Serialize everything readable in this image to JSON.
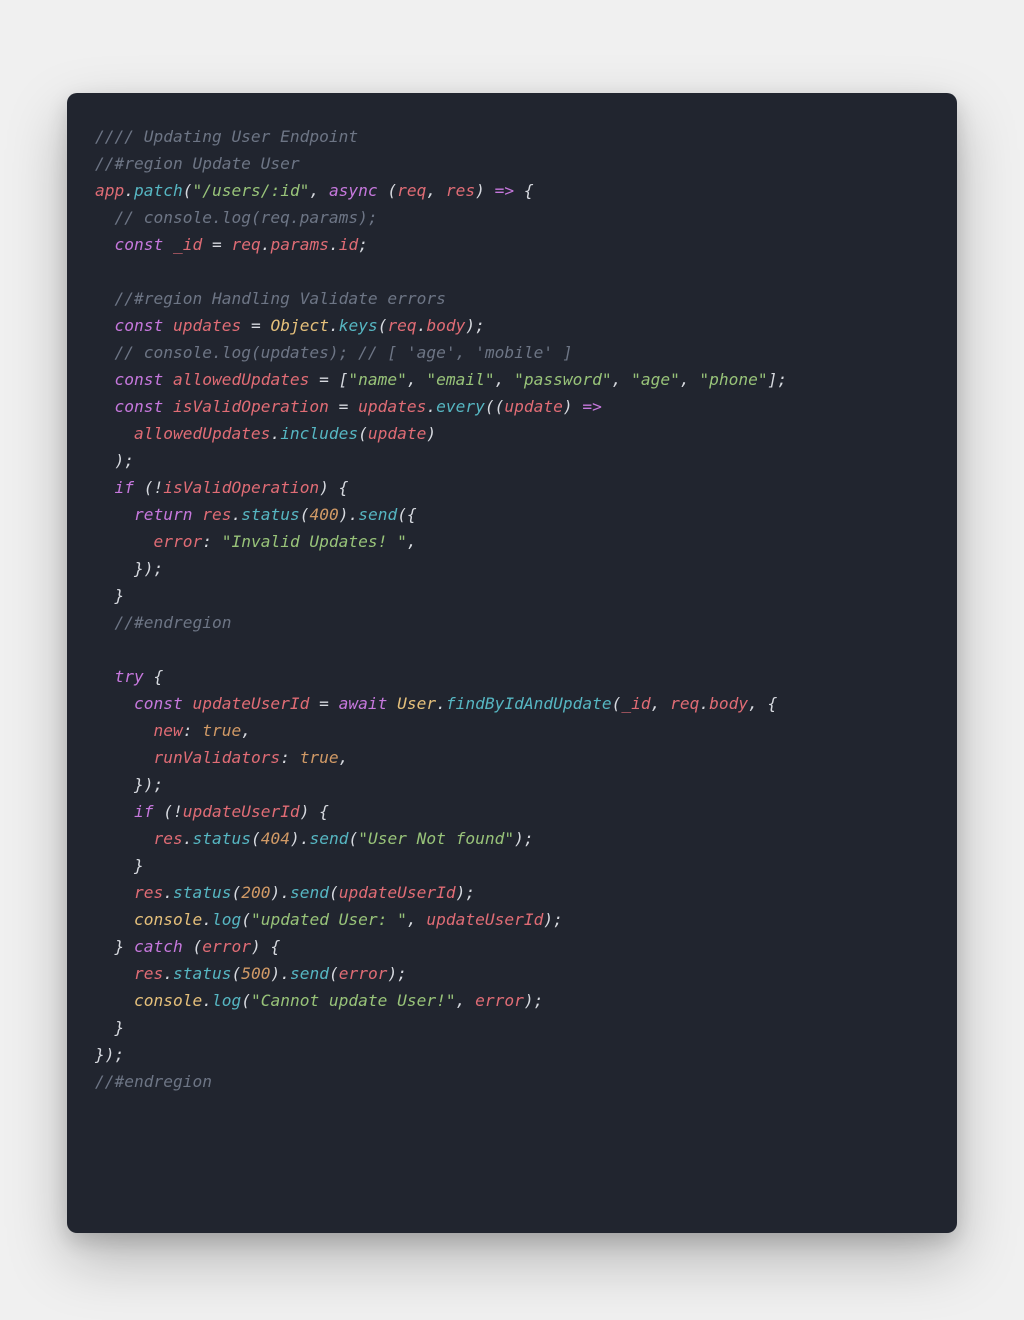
{
  "code": {
    "lines": [
      [
        {
          "c": "tok-comment",
          "t": "//// Updating User Endpoint"
        }
      ],
      [
        {
          "c": "tok-comment",
          "t": "//#region Update User"
        }
      ],
      [
        {
          "c": "tok-ident",
          "t": "app"
        },
        {
          "c": "tok-punc",
          "t": "."
        },
        {
          "c": "tok-func",
          "t": "patch"
        },
        {
          "c": "tok-punc",
          "t": "("
        },
        {
          "c": "tok-str",
          "t": "\"/users/:id\""
        },
        {
          "c": "tok-punc",
          "t": ", "
        },
        {
          "c": "tok-key",
          "t": "async"
        },
        {
          "c": "tok-punc",
          "t": " ("
        },
        {
          "c": "tok-ident",
          "t": "req"
        },
        {
          "c": "tok-punc",
          "t": ", "
        },
        {
          "c": "tok-ident",
          "t": "res"
        },
        {
          "c": "tok-punc",
          "t": ") "
        },
        {
          "c": "tok-arrow",
          "t": "=>"
        },
        {
          "c": "tok-punc",
          "t": " {"
        }
      ],
      [
        {
          "c": "tok-punc",
          "t": "  "
        },
        {
          "c": "tok-comment",
          "t": "// console.log(req.params);"
        }
      ],
      [
        {
          "c": "tok-punc",
          "t": "  "
        },
        {
          "c": "tok-key",
          "t": "const"
        },
        {
          "c": "tok-punc",
          "t": " "
        },
        {
          "c": "tok-ident",
          "t": "_id"
        },
        {
          "c": "tok-punc",
          "t": " = "
        },
        {
          "c": "tok-ident",
          "t": "req"
        },
        {
          "c": "tok-punc",
          "t": "."
        },
        {
          "c": "tok-member",
          "t": "params"
        },
        {
          "c": "tok-punc",
          "t": "."
        },
        {
          "c": "tok-member",
          "t": "id"
        },
        {
          "c": "tok-punc",
          "t": ";"
        }
      ],
      [
        {
          "c": "tok-punc",
          "t": " "
        }
      ],
      [
        {
          "c": "tok-punc",
          "t": "  "
        },
        {
          "c": "tok-comment",
          "t": "//#region Handling Validate errors"
        }
      ],
      [
        {
          "c": "tok-punc",
          "t": "  "
        },
        {
          "c": "tok-key",
          "t": "const"
        },
        {
          "c": "tok-punc",
          "t": " "
        },
        {
          "c": "tok-ident",
          "t": "updates"
        },
        {
          "c": "tok-punc",
          "t": " = "
        },
        {
          "c": "tok-builtin",
          "t": "Object"
        },
        {
          "c": "tok-punc",
          "t": "."
        },
        {
          "c": "tok-func",
          "t": "keys"
        },
        {
          "c": "tok-punc",
          "t": "("
        },
        {
          "c": "tok-ident",
          "t": "req"
        },
        {
          "c": "tok-punc",
          "t": "."
        },
        {
          "c": "tok-member",
          "t": "body"
        },
        {
          "c": "tok-punc",
          "t": ");"
        }
      ],
      [
        {
          "c": "tok-punc",
          "t": "  "
        },
        {
          "c": "tok-comment",
          "t": "// console.log(updates); // [ 'age', 'mobile' ]"
        }
      ],
      [
        {
          "c": "tok-punc",
          "t": "  "
        },
        {
          "c": "tok-key",
          "t": "const"
        },
        {
          "c": "tok-punc",
          "t": " "
        },
        {
          "c": "tok-ident",
          "t": "allowedUpdates"
        },
        {
          "c": "tok-punc",
          "t": " = ["
        },
        {
          "c": "tok-str",
          "t": "\"name\""
        },
        {
          "c": "tok-punc",
          "t": ", "
        },
        {
          "c": "tok-str",
          "t": "\"email\""
        },
        {
          "c": "tok-punc",
          "t": ", "
        },
        {
          "c": "tok-str",
          "t": "\"password\""
        },
        {
          "c": "tok-punc",
          "t": ", "
        },
        {
          "c": "tok-str",
          "t": "\"age\""
        },
        {
          "c": "tok-punc",
          "t": ", "
        },
        {
          "c": "tok-str",
          "t": "\"phone\""
        },
        {
          "c": "tok-punc",
          "t": "];"
        }
      ],
      [
        {
          "c": "tok-punc",
          "t": "  "
        },
        {
          "c": "tok-key",
          "t": "const"
        },
        {
          "c": "tok-punc",
          "t": " "
        },
        {
          "c": "tok-ident",
          "t": "isValidOperation"
        },
        {
          "c": "tok-punc",
          "t": " = "
        },
        {
          "c": "tok-ident",
          "t": "updates"
        },
        {
          "c": "tok-punc",
          "t": "."
        },
        {
          "c": "tok-func",
          "t": "every"
        },
        {
          "c": "tok-punc",
          "t": "(("
        },
        {
          "c": "tok-ident",
          "t": "update"
        },
        {
          "c": "tok-punc",
          "t": ") "
        },
        {
          "c": "tok-arrow",
          "t": "=>"
        }
      ],
      [
        {
          "c": "tok-punc",
          "t": "    "
        },
        {
          "c": "tok-ident",
          "t": "allowedUpdates"
        },
        {
          "c": "tok-punc",
          "t": "."
        },
        {
          "c": "tok-func",
          "t": "includes"
        },
        {
          "c": "tok-punc",
          "t": "("
        },
        {
          "c": "tok-ident",
          "t": "update"
        },
        {
          "c": "tok-punc",
          "t": ")"
        }
      ],
      [
        {
          "c": "tok-punc",
          "t": "  );"
        }
      ],
      [
        {
          "c": "tok-punc",
          "t": "  "
        },
        {
          "c": "tok-key",
          "t": "if"
        },
        {
          "c": "tok-punc",
          "t": " (!"
        },
        {
          "c": "tok-ident",
          "t": "isValidOperation"
        },
        {
          "c": "tok-punc",
          "t": ") {"
        }
      ],
      [
        {
          "c": "tok-punc",
          "t": "    "
        },
        {
          "c": "tok-key",
          "t": "return"
        },
        {
          "c": "tok-punc",
          "t": " "
        },
        {
          "c": "tok-ident",
          "t": "res"
        },
        {
          "c": "tok-punc",
          "t": "."
        },
        {
          "c": "tok-func",
          "t": "status"
        },
        {
          "c": "tok-punc",
          "t": "("
        },
        {
          "c": "tok-num",
          "t": "400"
        },
        {
          "c": "tok-punc",
          "t": ")."
        },
        {
          "c": "tok-func",
          "t": "send"
        },
        {
          "c": "tok-punc",
          "t": "({"
        }
      ],
      [
        {
          "c": "tok-punc",
          "t": "      "
        },
        {
          "c": "tok-objkey",
          "t": "error"
        },
        {
          "c": "tok-punc",
          "t": ": "
        },
        {
          "c": "tok-str",
          "t": "\"Invalid Updates! \""
        },
        {
          "c": "tok-punc",
          "t": ","
        }
      ],
      [
        {
          "c": "tok-punc",
          "t": "    });"
        }
      ],
      [
        {
          "c": "tok-punc",
          "t": "  }"
        }
      ],
      [
        {
          "c": "tok-punc",
          "t": "  "
        },
        {
          "c": "tok-comment",
          "t": "//#endregion"
        }
      ],
      [
        {
          "c": "tok-punc",
          "t": " "
        }
      ],
      [
        {
          "c": "tok-punc",
          "t": "  "
        },
        {
          "c": "tok-key",
          "t": "try"
        },
        {
          "c": "tok-punc",
          "t": " {"
        }
      ],
      [
        {
          "c": "tok-punc",
          "t": "    "
        },
        {
          "c": "tok-key",
          "t": "const"
        },
        {
          "c": "tok-punc",
          "t": " "
        },
        {
          "c": "tok-ident",
          "t": "updateUserId"
        },
        {
          "c": "tok-punc",
          "t": " = "
        },
        {
          "c": "tok-key",
          "t": "await"
        },
        {
          "c": "tok-punc",
          "t": " "
        },
        {
          "c": "tok-builtin",
          "t": "User"
        },
        {
          "c": "tok-punc",
          "t": "."
        },
        {
          "c": "tok-func",
          "t": "findByIdAndUpdate"
        },
        {
          "c": "tok-punc",
          "t": "("
        },
        {
          "c": "tok-ident",
          "t": "_id"
        },
        {
          "c": "tok-punc",
          "t": ", "
        },
        {
          "c": "tok-ident",
          "t": "req"
        },
        {
          "c": "tok-punc",
          "t": "."
        },
        {
          "c": "tok-member",
          "t": "body"
        },
        {
          "c": "tok-punc",
          "t": ", {"
        }
      ],
      [
        {
          "c": "tok-punc",
          "t": "      "
        },
        {
          "c": "tok-objkey",
          "t": "new"
        },
        {
          "c": "tok-punc",
          "t": ": "
        },
        {
          "c": "tok-bool",
          "t": "true"
        },
        {
          "c": "tok-punc",
          "t": ","
        }
      ],
      [
        {
          "c": "tok-punc",
          "t": "      "
        },
        {
          "c": "tok-objkey",
          "t": "runValidators"
        },
        {
          "c": "tok-punc",
          "t": ": "
        },
        {
          "c": "tok-bool",
          "t": "true"
        },
        {
          "c": "tok-punc",
          "t": ","
        }
      ],
      [
        {
          "c": "tok-punc",
          "t": "    });"
        }
      ],
      [
        {
          "c": "tok-punc",
          "t": "    "
        },
        {
          "c": "tok-key",
          "t": "if"
        },
        {
          "c": "tok-punc",
          "t": " (!"
        },
        {
          "c": "tok-ident",
          "t": "updateUserId"
        },
        {
          "c": "tok-punc",
          "t": ") {"
        }
      ],
      [
        {
          "c": "tok-punc",
          "t": "      "
        },
        {
          "c": "tok-ident",
          "t": "res"
        },
        {
          "c": "tok-punc",
          "t": "."
        },
        {
          "c": "tok-func",
          "t": "status"
        },
        {
          "c": "tok-punc",
          "t": "("
        },
        {
          "c": "tok-num",
          "t": "404"
        },
        {
          "c": "tok-punc",
          "t": ")."
        },
        {
          "c": "tok-func",
          "t": "send"
        },
        {
          "c": "tok-punc",
          "t": "("
        },
        {
          "c": "tok-str",
          "t": "\"User Not found\""
        },
        {
          "c": "tok-punc",
          "t": ");"
        }
      ],
      [
        {
          "c": "tok-punc",
          "t": "    }"
        }
      ],
      [
        {
          "c": "tok-punc",
          "t": "    "
        },
        {
          "c": "tok-ident",
          "t": "res"
        },
        {
          "c": "tok-punc",
          "t": "."
        },
        {
          "c": "tok-func",
          "t": "status"
        },
        {
          "c": "tok-punc",
          "t": "("
        },
        {
          "c": "tok-num",
          "t": "200"
        },
        {
          "c": "tok-punc",
          "t": ")."
        },
        {
          "c": "tok-func",
          "t": "send"
        },
        {
          "c": "tok-punc",
          "t": "("
        },
        {
          "c": "tok-ident",
          "t": "updateUserId"
        },
        {
          "c": "tok-punc",
          "t": ");"
        }
      ],
      [
        {
          "c": "tok-punc",
          "t": "    "
        },
        {
          "c": "tok-builtin",
          "t": "console"
        },
        {
          "c": "tok-punc",
          "t": "."
        },
        {
          "c": "tok-func",
          "t": "log"
        },
        {
          "c": "tok-punc",
          "t": "("
        },
        {
          "c": "tok-str",
          "t": "\"updated User: \""
        },
        {
          "c": "tok-punc",
          "t": ", "
        },
        {
          "c": "tok-ident",
          "t": "updateUserId"
        },
        {
          "c": "tok-punc",
          "t": ");"
        }
      ],
      [
        {
          "c": "tok-punc",
          "t": "  } "
        },
        {
          "c": "tok-key",
          "t": "catch"
        },
        {
          "c": "tok-punc",
          "t": " ("
        },
        {
          "c": "tok-ident",
          "t": "error"
        },
        {
          "c": "tok-punc",
          "t": ") {"
        }
      ],
      [
        {
          "c": "tok-punc",
          "t": "    "
        },
        {
          "c": "tok-ident",
          "t": "res"
        },
        {
          "c": "tok-punc",
          "t": "."
        },
        {
          "c": "tok-func",
          "t": "status"
        },
        {
          "c": "tok-punc",
          "t": "("
        },
        {
          "c": "tok-num",
          "t": "500"
        },
        {
          "c": "tok-punc",
          "t": ")."
        },
        {
          "c": "tok-func",
          "t": "send"
        },
        {
          "c": "tok-punc",
          "t": "("
        },
        {
          "c": "tok-ident",
          "t": "error"
        },
        {
          "c": "tok-punc",
          "t": ");"
        }
      ],
      [
        {
          "c": "tok-punc",
          "t": "    "
        },
        {
          "c": "tok-builtin",
          "t": "console"
        },
        {
          "c": "tok-punc",
          "t": "."
        },
        {
          "c": "tok-func",
          "t": "log"
        },
        {
          "c": "tok-punc",
          "t": "("
        },
        {
          "c": "tok-str",
          "t": "\"Cannot update User!\""
        },
        {
          "c": "tok-punc",
          "t": ", "
        },
        {
          "c": "tok-ident",
          "t": "error"
        },
        {
          "c": "tok-punc",
          "t": ");"
        }
      ],
      [
        {
          "c": "tok-punc",
          "t": "  }"
        }
      ],
      [
        {
          "c": "tok-punc",
          "t": "});"
        }
      ],
      [
        {
          "c": "tok-comment",
          "t": "//#endregion"
        }
      ]
    ]
  }
}
